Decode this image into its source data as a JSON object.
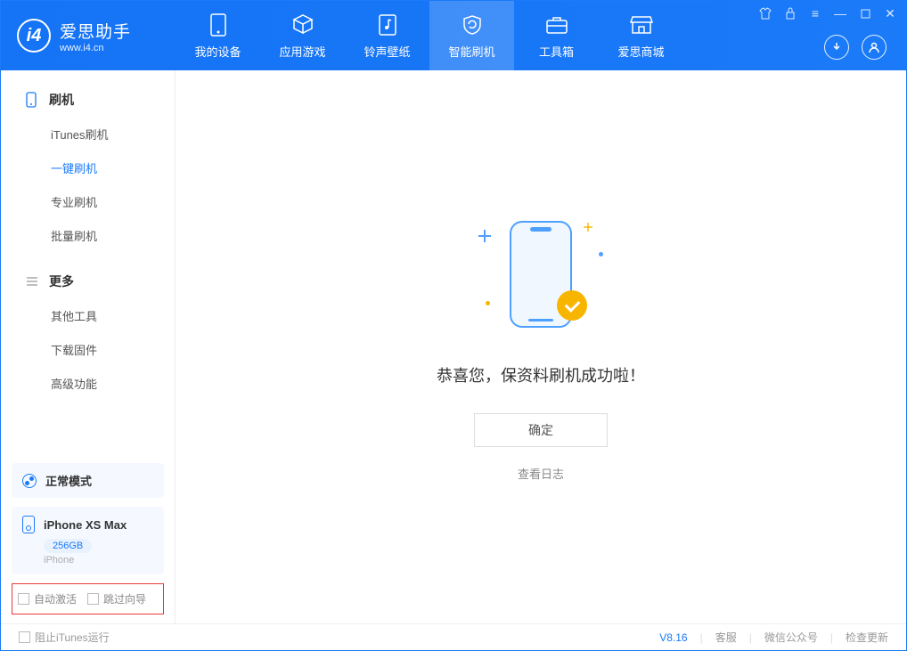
{
  "app": {
    "name_cn": "爱思助手",
    "name_en": "www.i4.cn"
  },
  "nav": {
    "items": [
      {
        "label": "我的设备"
      },
      {
        "label": "应用游戏"
      },
      {
        "label": "铃声壁纸"
      },
      {
        "label": "智能刷机"
      },
      {
        "label": "工具箱"
      },
      {
        "label": "爱思商城"
      }
    ],
    "active_index": 3
  },
  "sidebar": {
    "section1": {
      "title": "刷机",
      "items": [
        {
          "label": "iTunes刷机"
        },
        {
          "label": "一键刷机"
        },
        {
          "label": "专业刷机"
        },
        {
          "label": "批量刷机"
        }
      ],
      "active_index": 1
    },
    "section2": {
      "title": "更多",
      "items": [
        {
          "label": "其他工具"
        },
        {
          "label": "下载固件"
        },
        {
          "label": "高级功能"
        }
      ]
    },
    "mode": "正常模式",
    "device": {
      "name": "iPhone XS Max",
      "storage": "256GB",
      "type": "iPhone"
    },
    "options": {
      "auto_activate": "自动激活",
      "skip_guide": "跳过向导"
    }
  },
  "main": {
    "success_message": "恭喜您，保资料刷机成功啦！",
    "ok_button": "确定",
    "view_log": "查看日志"
  },
  "footer": {
    "block_itunes": "阻止iTunes运行",
    "version": "V8.16",
    "links": {
      "service": "客服",
      "wechat": "微信公众号",
      "update": "检查更新"
    }
  }
}
